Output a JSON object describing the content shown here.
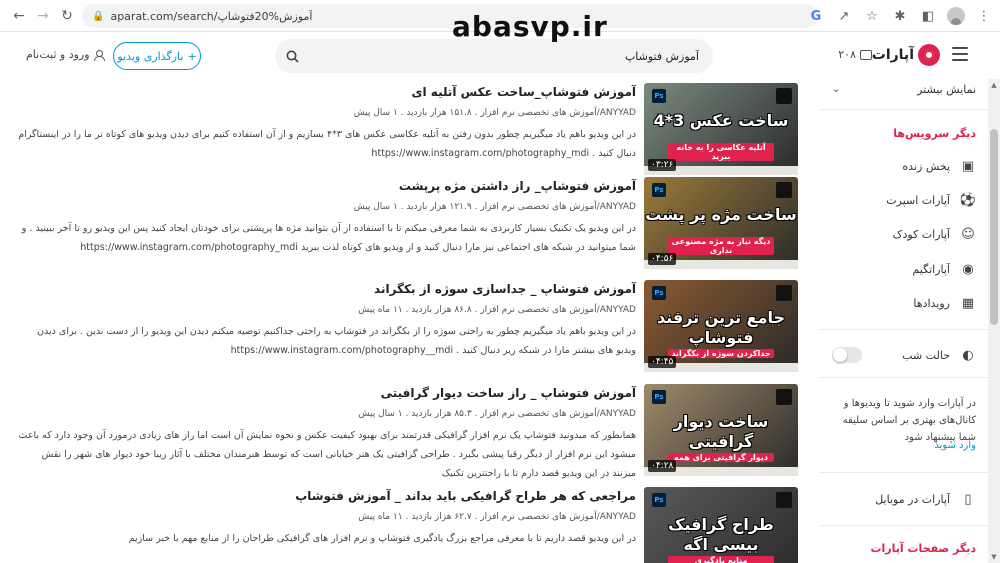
{
  "browser": {
    "url": "aparat.com/search/آموزش%20فتوشاپ"
  },
  "watermark": "abasvp.ir",
  "header": {
    "logo_text": "آپارات",
    "notification_count": "۲۰۸",
    "search_value": "آموزش فتوشاپ",
    "upload_label": "بارگذاری ویدیو",
    "upload_plus": "+",
    "login_label": "ورود و ثبت‌نام"
  },
  "sidebar": {
    "collapsed_item": "نمایش بیشتر",
    "services_heading": "دیگر سرویس‌ها",
    "items": [
      {
        "label": "پخش زنده",
        "icon": "live-icon"
      },
      {
        "label": "آپارات اسپرت",
        "icon": "sport-icon"
      },
      {
        "label": "آپارات کودک",
        "icon": "kids-icon"
      },
      {
        "label": "آپاراتگیم",
        "icon": "game-icon"
      },
      {
        "label": "رویدادها",
        "icon": "calendar-icon"
      }
    ],
    "dark_mode_label": "حالت شب",
    "login_prompt": "در آپارات وارد شوید تا ویدیوها و کانال‌های بهتری بر اساس سلیقه شما پیشنهاد شود",
    "login_link": "وارد شوید",
    "mobile_label": "آپارات در موبایل",
    "pages_heading": "دیگر صفحات آپارات"
  },
  "results": [
    {
      "title": "آموزش فتوشاپ_ساخت عکس آتلیه ای",
      "channel": "ANYYAD/آموزش های تخصصی نرم افزار",
      "views": "۱۵۱.۸ هزار بازدید",
      "age": "۱ سال پیش",
      "desc": "در این ویدیو باهم یاد میگیریم چطور بدون رفتن به آتلیه عکاسی عکس های ۳*۴ بسازیم و از آن استفاده کنیم برای دیدن ویدیو های کوتاه تر ما را در اینستاگرام دنبال کنید .",
      "url": "https://www.instagram.com/photography_mdi",
      "thumb_title": "ساخت عکس 3*4",
      "thumb_sub": "آتلیه عکاسی را به خانه ببرید",
      "duration": "۰۳:۲۶",
      "thumb_color": "#7a8a80"
    },
    {
      "title": "آموزش فتوشاپ_ راز داشتن مژه پرپشت",
      "channel": "ANYYAD/آموزش های تخصصی نرم افزار",
      "views": "۱۲۱.۹ هزار بازدید",
      "age": "۱ سال پیش",
      "desc": "در این ویدیو یک تکنیک بسیار کاربردی به شما معرفی میکنم تا با استفاده از آن بتوانید مژه ها پرپشتی برای خودتان ایجاد کنید پس این ویدیو رو تا آخر ببینید . و شما میتوانید در شبکه های اجتماعی نیز مارا دنبال کنید و از ویدیو های کوتاه لذت ببرید",
      "url": "https://www.instagram.com/photography_mdi",
      "thumb_title": "ساخت مژه پر پشت",
      "thumb_sub": "دیگه نیاز به مژه مصنوعی نداری",
      "duration": "۰۴:۵۶",
      "thumb_color": "#9a7a3a"
    },
    {
      "title": "آموزش فتوشاپ _ جداسازی سوژه از بکگراند",
      "channel": "ANYYAD/آموزش های تخصصی نرم افزار",
      "views": "۸۶.۸ هزار بازدید",
      "age": "۱۱ ماه پیش",
      "desc": "در این ویدیو باهم یاد میگیریم چطور به راحتی سوژه را از بکگراند در فتوشاپ به راحتی جداکنیم توصیه میکنم دیدن این ویدیو را از دست ندین . برای دیدن ویدیو های بیشتر مارا در شبکه زیر دنبال کنید .",
      "url": "https://www.instagram.com/photography__mdi",
      "thumb_title": "جامع ترین ترفند فتوشاپ",
      "thumb_sub": "جداکردن سوژه از بکگراند",
      "duration": "۰۴:۴۵",
      "thumb_color": "#8a5a30"
    },
    {
      "title": "آموزش فتوشاپ _ راز ساخت دیوار گرافیتی",
      "channel": "ANYYAD/آموزش های تخصصی نرم افزار",
      "views": "۸۵.۳ هزار بازدید",
      "age": "۱ سال پیش",
      "desc": "همانطور که میدونید فتوشاپ یک نرم افزار گرافیکی قدرتمند برای بهبود کیفیت عکس و نحوه نمایش آن است اما راز های زیادی درمورد آن وجود دارد که باعث میشود این نرم افزار از دیگر رقبا پیشی بگیرد . طراحی گرافیتی یک هنر خیابانی است که توسط هنرمندان مختلف با آثار زیبا خود دیوار های شهر را نقش میزنند در این ویدیو قصد دارم تا با راحتترین تکنیک",
      "url": "",
      "thumb_title": "ساخت دیوار گرافیتی",
      "thumb_sub": "دیوار گرافیتی برای همه",
      "duration": "۰۴:۲۸",
      "thumb_color": "#a08a6a"
    },
    {
      "title": "مراجعی که هر طراح گرافیکی باید بداند _ آموزش فتوشاپ",
      "channel": "ANYYAD/آموزش های تخصصی نرم افزار",
      "views": "۶۲.۷ هزار بازدید",
      "age": "۱۱ ماه پیش",
      "desc": "در این ویدیو قصد داریم تا با معرفی مراجع بزرگ یادگیری فتوشاپ و نرم افزار های گرافیکی طراحان را از منابع مهم با خبر سازیم",
      "url": "",
      "thumb_title": "طراح گرافیک بیسی اگه",
      "thumb_sub": "منابع یادگیری",
      "duration": "",
      "thumb_color": "#5a5a5a"
    }
  ],
  "thumb_brand": "ANYYAD",
  "ps_badge": "Ps"
}
